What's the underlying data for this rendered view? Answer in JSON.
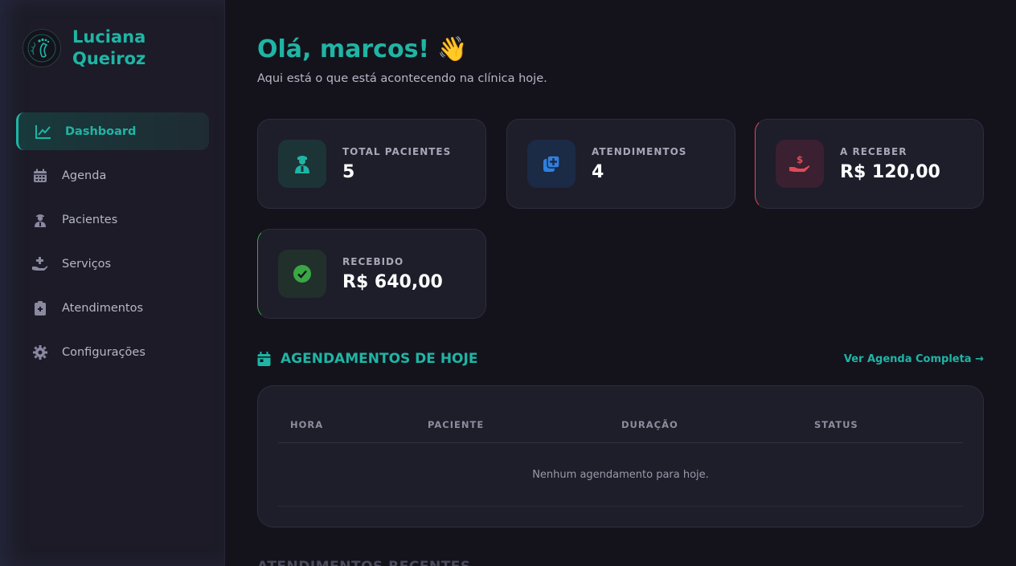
{
  "brand": {
    "name_line1": "Luciana",
    "name_line2": "Queiroz",
    "logo_icon": "foot-icon"
  },
  "sidebar": {
    "items": [
      {
        "label": "Dashboard",
        "icon": "chart-line-icon",
        "active": true
      },
      {
        "label": "Agenda",
        "icon": "calendar-icon",
        "active": false
      },
      {
        "label": "Pacientes",
        "icon": "user-doctor-icon",
        "active": false
      },
      {
        "label": "Serviços",
        "icon": "hand-medical-icon",
        "active": false
      },
      {
        "label": "Atendimentos",
        "icon": "clipboard-icon",
        "active": false
      },
      {
        "label": "Configurações",
        "icon": "gear-icon",
        "active": false
      }
    ]
  },
  "header": {
    "greeting": "Olá, marcos!",
    "wave_emoji": "👋",
    "subtitle": "Aqui está o que está acontecendo na clínica hoje."
  },
  "stats": [
    {
      "label": "TOTAL PACIENTES",
      "value": "5",
      "icon": "user-nurse-icon",
      "color": "#1fb5a5"
    },
    {
      "label": "ATENDIMENTOS",
      "value": "4",
      "icon": "file-medical-icon",
      "color": "#2f7fe0"
    },
    {
      "label": "A RECEBER",
      "value": "R$ 120,00",
      "icon": "hand-dollar-icon",
      "color": "#e04a58"
    },
    {
      "label": "RECEBIDO",
      "value": "R$ 640,00",
      "icon": "check-circle-icon",
      "color": "#3aa745"
    }
  ],
  "appointments": {
    "title": "AGENDAMENTOS DE HOJE",
    "see_all": "Ver Agenda Completa →",
    "columns": [
      "HORA",
      "PACIENTE",
      "DURAÇÃO",
      "STATUS"
    ],
    "empty_text": "Nenhum agendamento para hoje."
  },
  "recent": {
    "title": "ATENDIMENTOS RECENTES"
  },
  "colors": {
    "accent": "#1fb5a5",
    "bg": "#14131c",
    "sidebar": "#1c1b27",
    "card": "#1e1d2a"
  }
}
